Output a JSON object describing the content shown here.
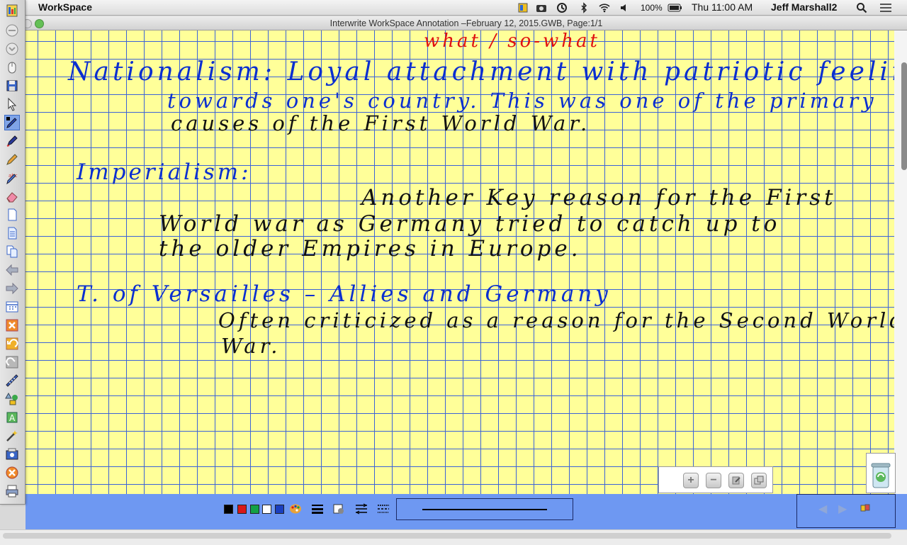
{
  "menubar": {
    "app_name": "WorkSpace",
    "battery": "100%",
    "clock": "Thu 11:00 AM",
    "user": "Jeff Marshall2"
  },
  "window": {
    "title": "Interwrite WorkSpace Annotation –February 12, 2015.GWB, Page:1/1"
  },
  "toolbar": {
    "tools": [
      "menu-icon",
      "minimize-icon",
      "hide-icon",
      "mouse-mode-icon",
      "save-icon",
      "select-arrow-icon",
      "pen-icon",
      "highlighter-icon",
      "pencil-icon",
      "spellcheck-icon",
      "eraser-icon",
      "new-page-icon",
      "page-list-icon",
      "duplicate-page-icon",
      "back-arrow-icon",
      "forward-arrow-icon",
      "calendar-icon",
      "delete-icon",
      "undo-icon",
      "redo-icon",
      "ruler-icon",
      "shapes-icon",
      "text-tool-icon",
      "magic-wand-icon",
      "camera-icon",
      "close-icon",
      "print-icon"
    ],
    "active_tool": "pen-icon"
  },
  "page": {
    "header": "what / so-what",
    "notes": [
      {
        "line": "Nationalism: Loyal attachment with patriotic feelings"
      },
      {
        "line": "towards one's country. This was one of the primary"
      },
      {
        "line": "causes of the First World War."
      },
      {
        "line": "Imperialism:"
      },
      {
        "line": "Another Key reason for the First"
      },
      {
        "line": "World war as Germany tried to catch up to"
      },
      {
        "line": "the older Empires in Europe."
      },
      {
        "line": "T. of Versailles – Allies and Germany"
      },
      {
        "line": "Often criticized as a reason for the Second World"
      },
      {
        "line": "War."
      }
    ]
  },
  "zoom_panel": {
    "buttons": [
      "zoom-in-icon",
      "zoom-out-icon",
      "page-edit-icon",
      "page-fit-icon"
    ]
  },
  "palette": {
    "colors": [
      "#000000",
      "#d81818",
      "#13a046",
      "#ffffff",
      "#1a3fbf"
    ],
    "accent": "#6e98f2",
    "canvas": "#ffff99",
    "grid": "#3c63d8"
  }
}
